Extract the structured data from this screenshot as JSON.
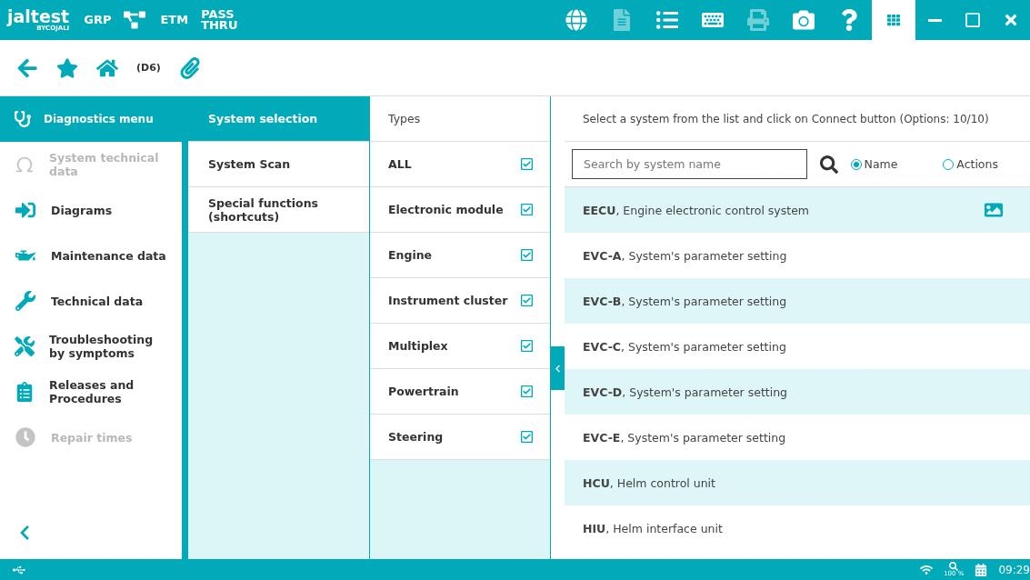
{
  "header": {
    "logo": "jaltest",
    "logo_sub": "BYCOJALI",
    "modes": [
      {
        "kind": "text",
        "label": "GRP"
      },
      {
        "kind": "icon"
      },
      {
        "kind": "text",
        "label": "ETM"
      },
      {
        "kind": "text",
        "label": "PASS THRU"
      }
    ],
    "tools": [
      {
        "kind": "globe",
        "disabled": false
      },
      {
        "kind": "document",
        "disabled": true
      },
      {
        "kind": "list",
        "disabled": false
      },
      {
        "kind": "keyboard",
        "disabled": false
      },
      {
        "kind": "printer",
        "disabled": true
      },
      {
        "kind": "camera",
        "disabled": false
      },
      {
        "kind": "help",
        "disabled": false
      }
    ]
  },
  "toolbar": {
    "code": "(D6)"
  },
  "menu": {
    "title": "Diagnostics menu",
    "items": [
      {
        "kind": "omega",
        "label": "System technical data",
        "disabled": true
      },
      {
        "kind": "diagram",
        "label": "Diagrams",
        "disabled": false
      },
      {
        "kind": "oil",
        "label": "Maintenance data",
        "disabled": false
      },
      {
        "kind": "wrench",
        "label": "Technical data",
        "disabled": false
      },
      {
        "kind": "trouble",
        "label": "Troubleshooting by symptoms",
        "disabled": false
      },
      {
        "kind": "doc",
        "label": "Releases and Procedures",
        "disabled": false
      },
      {
        "kind": "clock",
        "label": "Repair times",
        "disabled": true
      }
    ]
  },
  "functions": [
    {
      "label": "System selection",
      "selected": true
    },
    {
      "label": "System Scan",
      "selected": false
    },
    {
      "label": "Special functions (shortcuts)",
      "selected": false
    }
  ],
  "types": {
    "title": "Types",
    "items": [
      {
        "label": "ALL",
        "checked": true
      },
      {
        "label": "Electronic module",
        "checked": true
      },
      {
        "label": "Engine",
        "checked": true
      },
      {
        "label": "Instrument cluster",
        "checked": true
      },
      {
        "label": "Multiplex",
        "checked": true
      },
      {
        "label": "Powertrain",
        "checked": true
      },
      {
        "label": "Steering",
        "checked": true
      }
    ]
  },
  "systems": {
    "hint": "Select a system from the list and click on Connect button (Options: 10/10)",
    "search": {
      "placeholder": "Search by system name"
    },
    "filters": [
      {
        "label": "Name",
        "selected": true
      },
      {
        "label": "Actions",
        "selected": false
      }
    ],
    "rows": [
      {
        "code": "EECU",
        "desc": ", Engine electronic control system",
        "has_image": true
      },
      {
        "code": "EVC-A",
        "desc": ", System's parameter setting",
        "has_image": false
      },
      {
        "code": "EVC-B",
        "desc": ", System's parameter setting",
        "has_image": false
      },
      {
        "code": "EVC-C",
        "desc": ", System's parameter setting",
        "has_image": false
      },
      {
        "code": "EVC-D",
        "desc": ", System's parameter setting",
        "has_image": false
      },
      {
        "code": "EVC-E",
        "desc": ", System's parameter setting",
        "has_image": false
      },
      {
        "code": "HCU",
        "desc": ", Helm control unit",
        "has_image": false
      },
      {
        "code": "HIU",
        "desc": ", Helm interface unit",
        "has_image": false
      }
    ]
  },
  "status_bar": {
    "zoom": "100 %",
    "time": "09:29"
  }
}
